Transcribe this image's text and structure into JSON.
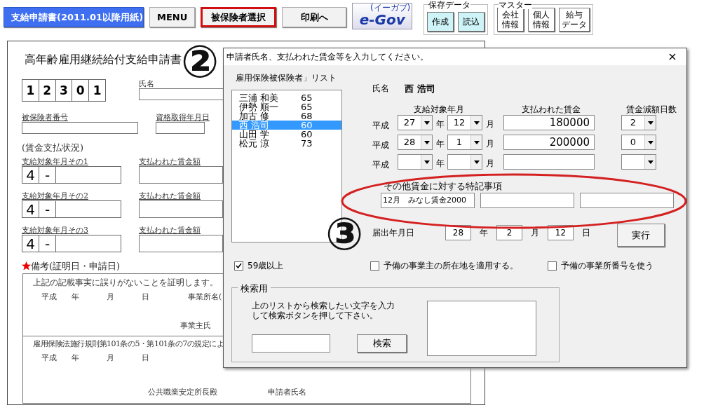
{
  "toolbar": {
    "buttons": [
      {
        "label": "支給申請書(2011.01以降用紙)",
        "kind": "primary",
        "highlighted": false
      },
      {
        "label": "MENU",
        "kind": "plain",
        "highlighted": false
      },
      {
        "label": "被保険者選択",
        "kind": "plain",
        "highlighted": true
      },
      {
        "label": "印刷へ",
        "kind": "plain",
        "highlighted": false
      }
    ],
    "logo": {
      "text": "e-Gov",
      "subtext": "(イーガブ)"
    },
    "groups": [
      {
        "title": "保存データ",
        "kind": "cyan",
        "buttons": [
          {
            "lines": [
              "作成"
            ]
          },
          {
            "lines": [
              "読込"
            ]
          }
        ]
      },
      {
        "title": "マスター",
        "kind": "white",
        "buttons": [
          {
            "lines": [
              "会社",
              "情報"
            ]
          },
          {
            "lines": [
              "個人",
              "情報"
            ]
          },
          {
            "lines": [
              "給与",
              "データ"
            ]
          }
        ]
      }
    ]
  },
  "sheet": {
    "title": "高年齢雇用継続給付支給申請書",
    "code_digits": [
      "1",
      "2",
      "3",
      "0",
      "1"
    ],
    "name_label": "氏名",
    "insured_number_label": "被保険者番号",
    "acquired_date_label": "資格取得年月日",
    "section_label": "(賃金支払状況)",
    "periods": [
      {
        "label": "支給対象年月その1",
        "prefix": "4",
        "dash": "-",
        "wage_label": "支払われた賃金額"
      },
      {
        "label": "支給対象年月その2",
        "prefix": "4",
        "dash": "-",
        "wage_label": "支払われた賃金額"
      },
      {
        "label": "支給対象年月その3",
        "prefix": "4",
        "dash": "-",
        "wage_label": "支払われた賃金額"
      }
    ],
    "remarks_label": "備考(証明日・申請日)",
    "certification": {
      "text": "上記の記載事実に誤りがないことを証明します。",
      "date_words": [
        "平成",
        "年",
        "月",
        "日"
      ],
      "office_label": "事業所名(",
      "owner_label": "事業主氏"
    },
    "regulation": {
      "text": "雇用保険法施行規則第101条の5・第101条の7の規定によ",
      "date_words": [
        "平成",
        "年",
        "月",
        "日"
      ],
      "office_label": "公共職業安定所長殿",
      "applicant_label": "申請者氏名"
    }
  },
  "dialog": {
    "title": "申請者氏名、支払われた賃金等を入力してください。",
    "close": "×",
    "list_label": "雇用保険被保険者」リスト",
    "list": [
      {
        "name": "三浦 和美",
        "age": "65",
        "selected": false
      },
      {
        "name": "伊勢 順一",
        "age": "65",
        "selected": false
      },
      {
        "name": "加古 修",
        "age": "68",
        "selected": false
      },
      {
        "name": "西 浩司",
        "age": "60",
        "selected": true
      },
      {
        "name": "山田 学",
        "age": "60",
        "selected": false
      },
      {
        "name": "松元 涼",
        "age": "73",
        "selected": false
      }
    ],
    "name_label": "氏名",
    "name_value": "西 浩司",
    "headers": [
      "支給対象年月",
      "支払われた賃金",
      "賃金減額日数"
    ],
    "rows": [
      {
        "era": "平成",
        "year": "27",
        "year_unit": "年",
        "month": "12",
        "month_unit": "月",
        "wage": "180000",
        "days": "2"
      },
      {
        "era": "平成",
        "year": "28",
        "year_unit": "年",
        "month": "1",
        "month_unit": "月",
        "wage": "200000",
        "days": "0"
      },
      {
        "era": "平成",
        "year_unit": "年",
        "month_unit": "月"
      }
    ],
    "notes_label": "その他賃金に対する特記事項",
    "notes_circled": true,
    "notes": [
      {
        "kind": "text",
        "value": "12月　みなし賃金2000"
      },
      {
        "kind": "text"
      },
      {
        "kind": "text"
      }
    ],
    "filing_date": {
      "label": "届出年月日",
      "year": "28",
      "year_unit": "年",
      "month": "2",
      "month_unit": "月",
      "day": "12",
      "day_unit": "日"
    },
    "execute": "実行",
    "checkboxes": [
      {
        "label": "59歳以上",
        "checked": true
      },
      {
        "label": "予備の事業主の所在地を適用する。",
        "checked": false
      },
      {
        "label": "予備の事業所番号を使う",
        "checked": false
      }
    ],
    "search": {
      "title": "検索用",
      "instructions": "上のリストから検索したい文字を入力して検索ボタンを押して下さい。",
      "button": "検索"
    }
  },
  "annotations": [
    {
      "text": "②"
    },
    {
      "text": "③"
    }
  ]
}
